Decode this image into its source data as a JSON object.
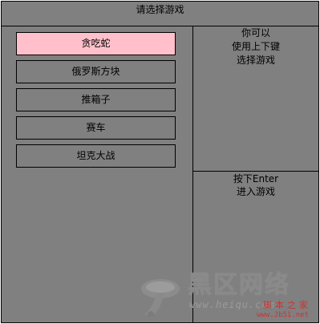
{
  "title": "请选择游戏",
  "games": [
    {
      "label": "贪吃蛇",
      "selected": true
    },
    {
      "label": "俄罗斯方块",
      "selected": false
    },
    {
      "label": "推箱子",
      "selected": false
    },
    {
      "label": "赛车",
      "selected": false
    },
    {
      "label": "坦克大战",
      "selected": false
    }
  ],
  "hint_top": [
    "你可以",
    "使用上下键",
    "选择游戏"
  ],
  "hint_bottom": [
    "按下Enter",
    "进入游戏"
  ],
  "colors": {
    "background": "#808080",
    "selected": "#ffc0cb",
    "border": "#000000"
  },
  "watermark": {
    "title": "黑区网络",
    "url": "www.heiqu.com",
    "tag": "脚本之家",
    "url2": "www.Jb51.net"
  }
}
